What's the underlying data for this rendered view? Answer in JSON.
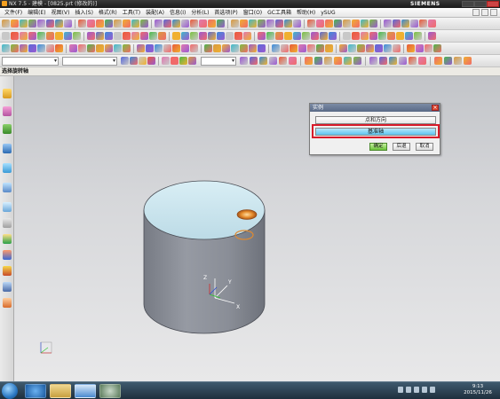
{
  "window": {
    "title": "NX 7.5 - 建模 - [0825.prt (修改的)]",
    "brand": "SIEMENS"
  },
  "menu": {
    "items": [
      "文件(F)",
      "编辑(E)",
      "视图(V)",
      "插入(S)",
      "格式(R)",
      "工具(T)",
      "装配(A)",
      "信息(I)",
      "分析(L)",
      "首选项(P)",
      "窗口(O)",
      "GC工具箱",
      "帮助(H)",
      "ySUG"
    ]
  },
  "cue_line": {
    "text": "选择旋转轴"
  },
  "toolbar_selects": {
    "filter": "",
    "scope": "",
    "snap": ""
  },
  "dialog": {
    "title": "实例",
    "option_point_direction": "点和方向",
    "option_datum_axis": "基准轴",
    "ok": "确定",
    "back": "后退",
    "cancel": "取消"
  },
  "taskbar": {
    "time": "9:13",
    "date": "2015/11/26"
  },
  "colors": {
    "title_bar": "#1a1a1a",
    "dialog_title": "#5a6a86",
    "selected_option": "#5cc5f0",
    "highlight_box": "#d81b2a",
    "cylinder_top": "#cfe6ee",
    "cylinder_side": "#8c9099",
    "hole_highlight": "#e07820"
  }
}
